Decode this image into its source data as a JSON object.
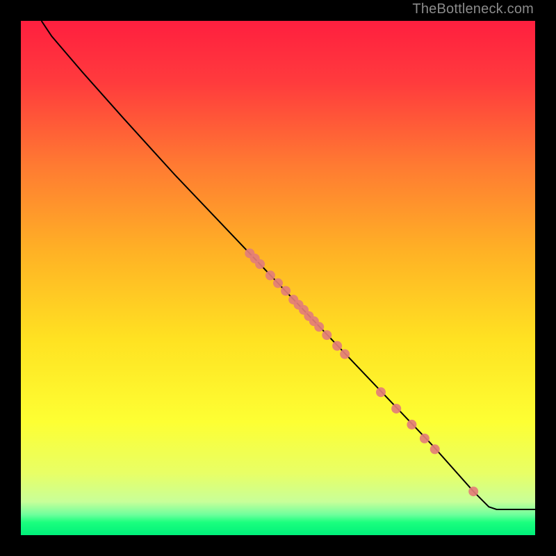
{
  "watermark": "TheBottleneck.com",
  "chart_data": {
    "type": "line",
    "title": "",
    "xlabel": "",
    "ylabel": "",
    "xlim": [
      0,
      100
    ],
    "ylim": [
      0,
      100
    ],
    "grid": false,
    "legend": "none",
    "background_gradient": {
      "stops": [
        {
          "offset": 0.0,
          "color": "#ff1f3f"
        },
        {
          "offset": 0.12,
          "color": "#ff3b3d"
        },
        {
          "offset": 0.28,
          "color": "#ff7a32"
        },
        {
          "offset": 0.45,
          "color": "#ffb225"
        },
        {
          "offset": 0.62,
          "color": "#ffe222"
        },
        {
          "offset": 0.78,
          "color": "#fdff33"
        },
        {
          "offset": 0.88,
          "color": "#e8ff66"
        },
        {
          "offset": 0.935,
          "color": "#c8ff99"
        },
        {
          "offset": 0.96,
          "color": "#6fff9d"
        },
        {
          "offset": 0.975,
          "color": "#1bff7e"
        },
        {
          "offset": 1.0,
          "color": "#00f07a"
        }
      ]
    },
    "series": [
      {
        "name": "curve",
        "type": "line",
        "color": "#000000",
        "points": [
          {
            "x": 4.0,
            "y": 100.0
          },
          {
            "x": 6.0,
            "y": 97.0
          },
          {
            "x": 9.0,
            "y": 93.5
          },
          {
            "x": 12.0,
            "y": 90.0
          },
          {
            "x": 16.0,
            "y": 85.5
          },
          {
            "x": 20.0,
            "y": 81.0
          },
          {
            "x": 25.0,
            "y": 75.5
          },
          {
            "x": 30.0,
            "y": 70.0
          },
          {
            "x": 40.0,
            "y": 59.5
          },
          {
            "x": 50.0,
            "y": 49.0
          },
          {
            "x": 60.0,
            "y": 38.5
          },
          {
            "x": 70.0,
            "y": 28.0
          },
          {
            "x": 80.0,
            "y": 17.5
          },
          {
            "x": 88.0,
            "y": 8.5
          },
          {
            "x": 91.0,
            "y": 5.5
          },
          {
            "x": 92.5,
            "y": 5.0
          },
          {
            "x": 100.0,
            "y": 5.0
          }
        ]
      },
      {
        "name": "markers",
        "type": "scatter",
        "color": "#e37e78",
        "radius": 7,
        "points": [
          {
            "x": 44.5,
            "y": 54.8
          },
          {
            "x": 45.5,
            "y": 53.8
          },
          {
            "x": 46.5,
            "y": 52.7
          },
          {
            "x": 48.5,
            "y": 50.5
          },
          {
            "x": 50.0,
            "y": 49.0
          },
          {
            "x": 51.5,
            "y": 47.5
          },
          {
            "x": 53.0,
            "y": 45.8
          },
          {
            "x": 54.0,
            "y": 44.8
          },
          {
            "x": 55.0,
            "y": 43.8
          },
          {
            "x": 56.0,
            "y": 42.6
          },
          {
            "x": 57.0,
            "y": 41.6
          },
          {
            "x": 58.0,
            "y": 40.5
          },
          {
            "x": 59.5,
            "y": 38.9
          },
          {
            "x": 61.5,
            "y": 36.8
          },
          {
            "x": 63.0,
            "y": 35.2
          },
          {
            "x": 70.0,
            "y": 27.8
          },
          {
            "x": 73.0,
            "y": 24.6
          },
          {
            "x": 76.0,
            "y": 21.5
          },
          {
            "x": 78.5,
            "y": 18.8
          },
          {
            "x": 80.5,
            "y": 16.7
          },
          {
            "x": 88.0,
            "y": 8.5
          }
        ]
      }
    ]
  }
}
